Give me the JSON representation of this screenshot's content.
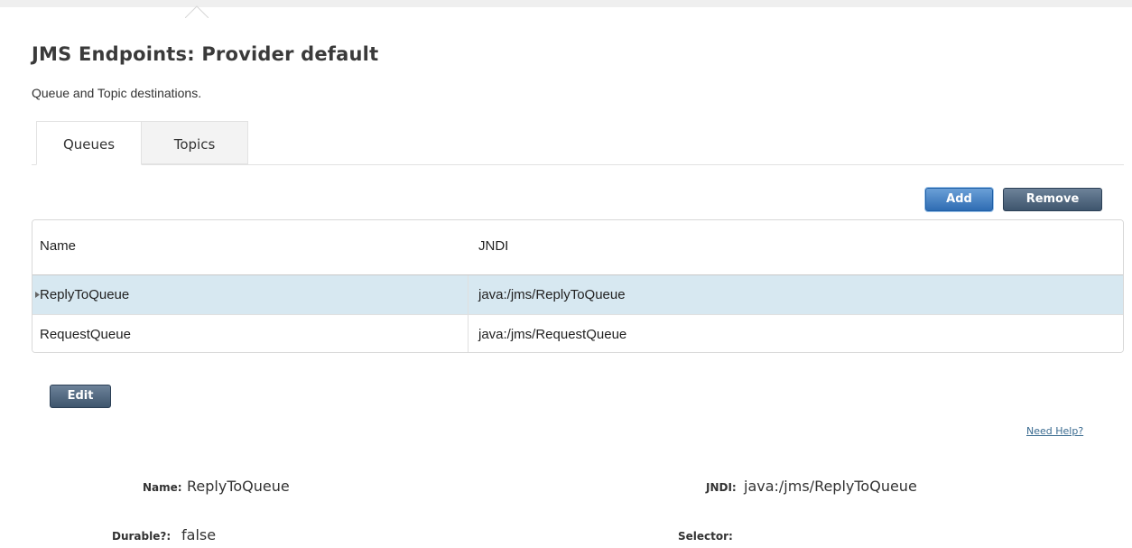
{
  "page": {
    "title": "JMS Endpoints: Provider default",
    "subtitle": "Queue and Topic destinations."
  },
  "tabs": [
    {
      "label": "Queues",
      "active": true
    },
    {
      "label": "Topics",
      "active": false
    }
  ],
  "toolbar": {
    "add_label": "Add",
    "remove_label": "Remove"
  },
  "table": {
    "columns": [
      "Name",
      "JNDI"
    ],
    "rows": [
      {
        "name": "ReplyToQueue",
        "jndi": "java:/jms/ReplyToQueue",
        "selected": true
      },
      {
        "name": "RequestQueue",
        "jndi": "java:/jms/RequestQueue",
        "selected": false
      }
    ]
  },
  "edit_label": "Edit",
  "help_label": "Need Help?",
  "details": {
    "name_label": "Name:",
    "name_value": "ReplyToQueue",
    "jndi_label": "JNDI:",
    "jndi_value": "java:/jms/ReplyToQueue",
    "durable_label": "Durable?:",
    "durable_value": "false",
    "selector_label": "Selector:",
    "selector_value": ""
  },
  "colors": {
    "selected_row": "#d7e8f1",
    "button_primary": "#2f6db3",
    "button_default": "#3e556d",
    "link": "#3a6b90"
  },
  "icons": {
    "row_marker": "selected-row-marker-icon"
  }
}
